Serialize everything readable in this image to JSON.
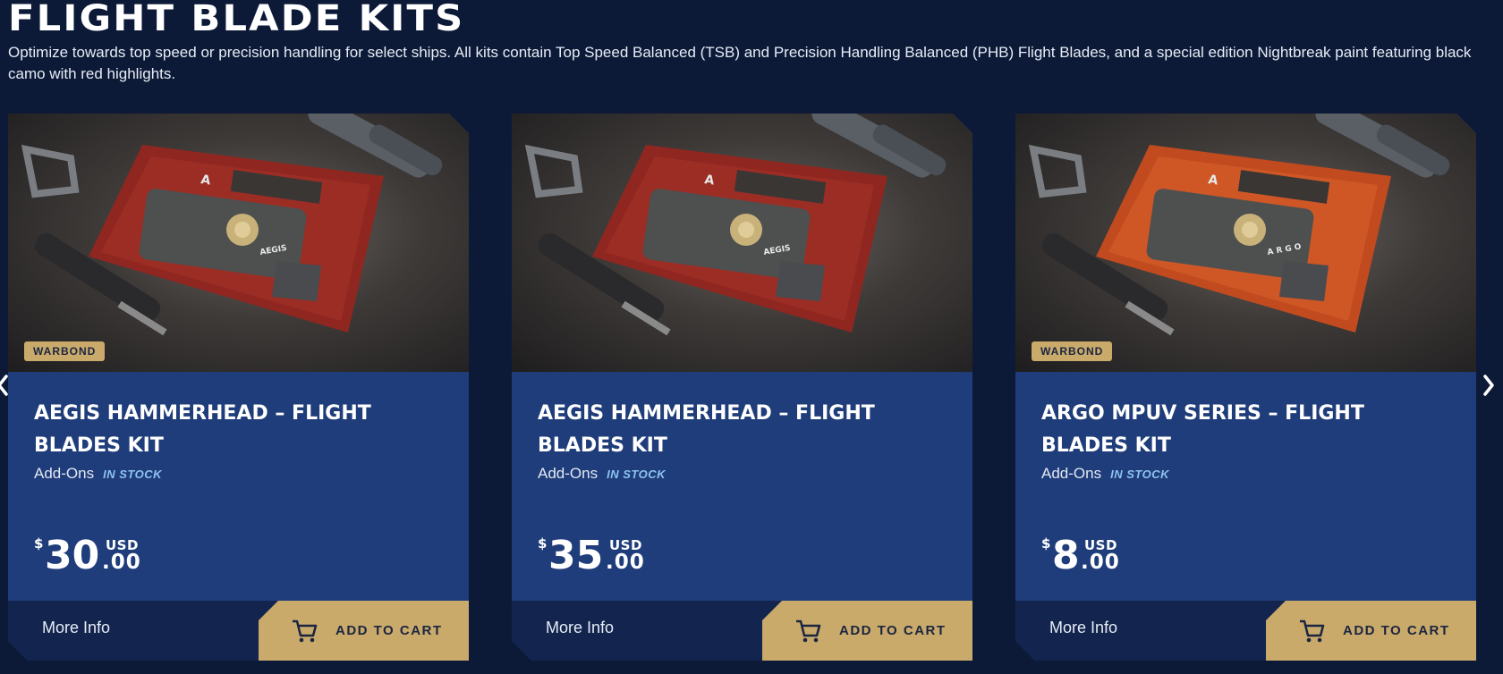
{
  "page": {
    "title": "FLIGHT BLADE KITS",
    "description": "Optimize towards top speed or precision handling for select ships. All kits contain Top Speed Balanced (TSB) and Precision Handling Balanced (PHB) Flight Blades, and a special edition Nightbreak paint featuring black camo with red highlights."
  },
  "colors": {
    "background": "#0c1a38",
    "card": "#1f3d7a",
    "card_footer": "#13254f",
    "accent_gold": "#c9aa6b",
    "stock_text": "#8ec3f0"
  },
  "cards": [
    {
      "badge": "WARBOND",
      "title": "AEGIS HAMMERHEAD – FLIGHT BLADES KIT",
      "category": "Add-Ons",
      "stock": "IN STOCK",
      "currency_symbol": "$",
      "price_whole": "30",
      "price_cents": ".00",
      "currency_code": "USD",
      "more_info": "More Info",
      "add_to_cart": "ADD TO CART",
      "image_logo": "A",
      "image_brand": "AEGIS",
      "kit_color": "#8f2720"
    },
    {
      "badge": "",
      "title": "AEGIS HAMMERHEAD – FLIGHT BLADES KIT",
      "category": "Add-Ons",
      "stock": "IN STOCK",
      "currency_symbol": "$",
      "price_whole": "35",
      "price_cents": ".00",
      "currency_code": "USD",
      "more_info": "More Info",
      "add_to_cart": "ADD TO CART",
      "image_logo": "A",
      "image_brand": "AEGIS",
      "kit_color": "#8f2720"
    },
    {
      "badge": "WARBOND",
      "title": "ARGO MPUV SERIES – FLIGHT BLADES KIT",
      "category": "Add-Ons",
      "stock": "IN STOCK",
      "currency_symbol": "$",
      "price_whole": "8",
      "price_cents": ".00",
      "currency_code": "USD",
      "more_info": "More Info",
      "add_to_cart": "ADD TO CART",
      "image_logo": "A",
      "image_brand": "A R G O",
      "kit_color": "#c14a1f"
    }
  ],
  "icons": {
    "cart": "cart-icon",
    "prev": "chevron-left-icon",
    "next": "chevron-right-icon"
  }
}
